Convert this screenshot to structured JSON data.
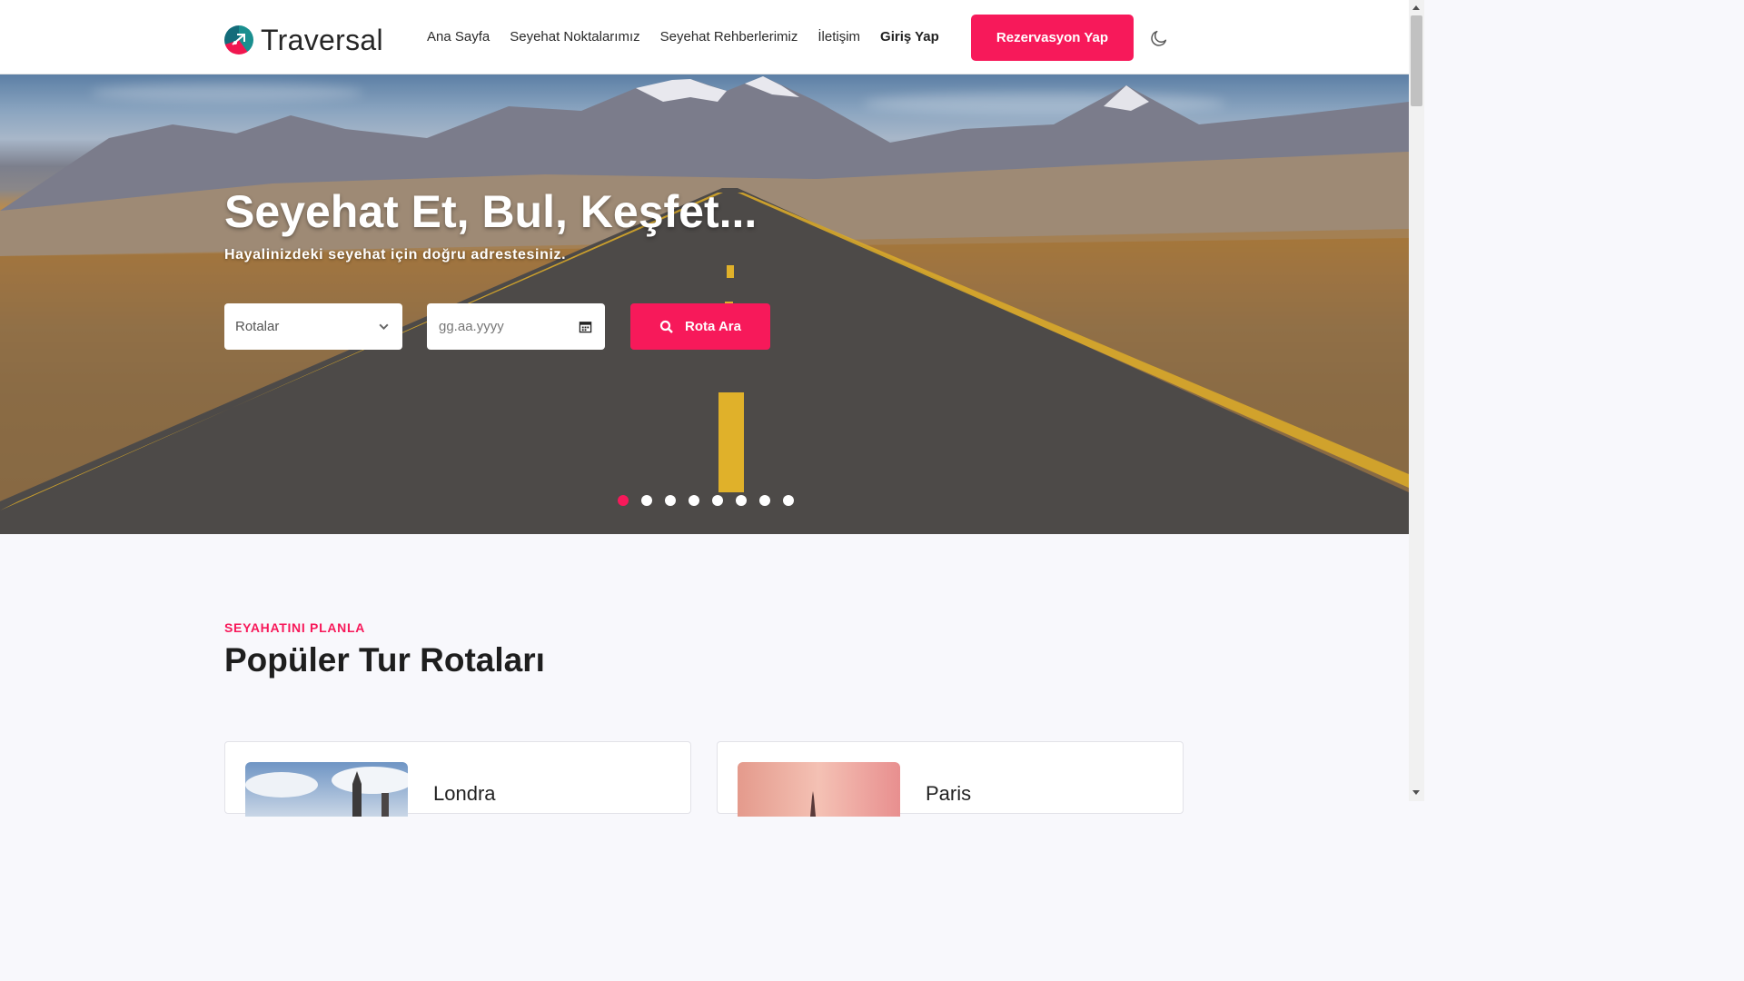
{
  "header": {
    "brand": "Traversal",
    "nav": [
      {
        "label": "Ana Sayfa"
      },
      {
        "label": "Seyehat Noktalarımız"
      },
      {
        "label": "Seyehat Rehberlerimiz"
      },
      {
        "label": "İletişim"
      },
      {
        "label": "Giriş Yap"
      }
    ],
    "cta_label": "Rezervasyon Yap",
    "theme_icon": "moon-icon"
  },
  "hero": {
    "title": "Seyehat Et, Bul, Keşfet...",
    "subtitle": "Hayalinizdeki seyehat için doğru adrestesiniz.",
    "route_select": {
      "value": "Rotalar",
      "icon": "chevron-down-icon"
    },
    "date_input": {
      "placeholder": "gg.aa.yyyy",
      "icon": "calendar-icon"
    },
    "search_button": {
      "label": "Rota Ara",
      "icon": "search-icon"
    },
    "slides": {
      "count": 8,
      "active_index": 0
    }
  },
  "section": {
    "tag": "SEYAHATINI PLANLA",
    "title": "Popüler Tur Rotaları"
  },
  "cards": [
    {
      "title": "Londra"
    },
    {
      "title": "Paris"
    }
  ],
  "colors": {
    "accent": "#f7195a",
    "background": "#f8f8fc",
    "header_bg": "#ffffff"
  }
}
